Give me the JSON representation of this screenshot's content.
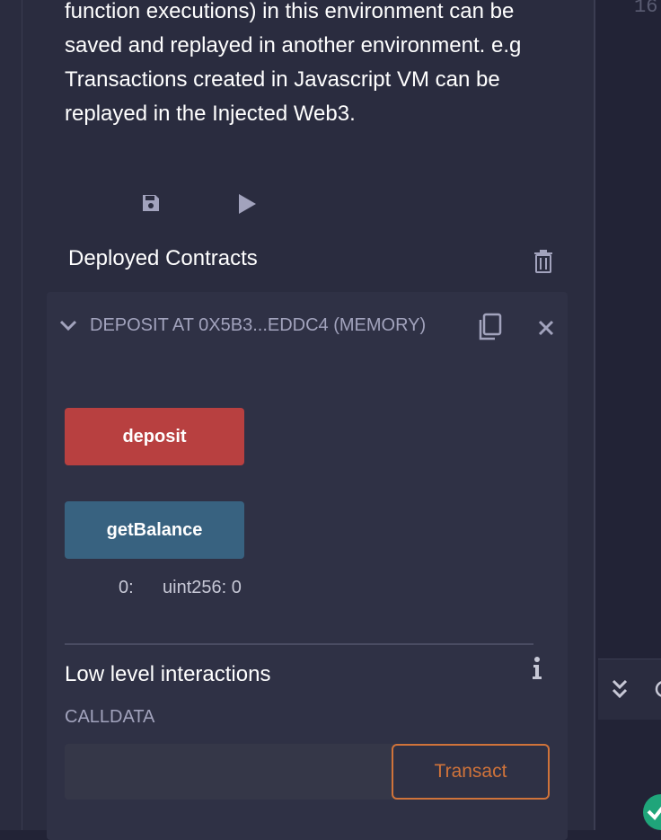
{
  "description": "function executions) in this environment can be saved and replayed in another environment. e.g Transactions created in Javascript VM can be replayed in the Injected Web3.",
  "deployed": {
    "title": "Deployed Contracts"
  },
  "instance": {
    "title": "DEPOSIT AT 0X5B3...EDDC4 (MEMORY)",
    "functions": [
      {
        "label": "deposit",
        "color": "#b84040"
      },
      {
        "label": "getBalance",
        "color": "#386280"
      }
    ],
    "output": {
      "index": "0:",
      "value": "uint256: 0"
    }
  },
  "low_level": {
    "title": "Low level interactions",
    "calldata_label": "CALLDATA",
    "calldata_value": "",
    "transact_label": "Transact"
  },
  "editor": {
    "line_number": "16"
  },
  "icons": {
    "save": "save-icon",
    "play": "play-icon",
    "trash": "trash-icon",
    "chevron": "chevron-down-icon",
    "copy": "copy-icon",
    "close": "close-icon",
    "info": "info-icon",
    "double_chevron": "double-chevron-down-icon",
    "check": "check-icon"
  },
  "colors": {
    "accent_orange": "#d0733a",
    "success_green": "#1fa57a"
  }
}
